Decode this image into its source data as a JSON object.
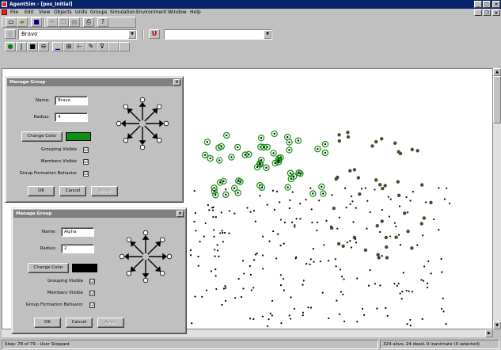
{
  "window": {
    "title": "AgentSim - [pos_Initial]"
  },
  "window_buttons": {
    "minimize": "_",
    "maximize": "□",
    "close": "×"
  },
  "mdi_buttons": {
    "minimize": "_",
    "restore": "❐",
    "close": "×"
  },
  "menu": [
    "File",
    "Edit",
    "View",
    "Objects",
    "Units",
    "Groups",
    "Simulation",
    "Environment",
    "Window",
    "Help"
  ],
  "toolbar": {
    "group_select": "Bravo",
    "second_combo": "",
    "buttons": [
      "new-icon",
      "open-icon",
      "save-icon",
      "cut-icon",
      "copy-icon",
      "paste-icon",
      "print-icon",
      "help-icon"
    ]
  },
  "status": {
    "left": "Step: 78 of 79 - User Stopped",
    "right": "324 alive, 24 dead, 0 inanimate (0 selected)"
  },
  "dialogs": [
    {
      "title": "Manage Group",
      "name_label": "Name:",
      "name": "Bravo",
      "radius_label": "Radius:",
      "radius": "4",
      "change_color": "Change Color",
      "color": "#109010",
      "grouping_visible_label": "Grouping Visible",
      "grouping_visible": "☑",
      "members_visible_label": "Members Visible",
      "members_visible": "☑",
      "formation_label": "Group Formation Behavior",
      "formation": "☑",
      "ok": "OK",
      "cancel": "Cancel",
      "apply": "Apply"
    },
    {
      "title": "Manage Group",
      "name_label": "Name:",
      "name": "Alpha",
      "radius_label": "Radius:",
      "radius": "2",
      "change_color": "Change Color",
      "color": "#000000",
      "grouping_visible_label": "Grouping Visible",
      "grouping_visible": "☑",
      "members_visible_label": "Members Visible",
      "members_visible": "☑",
      "formation_label": "Group Formation Behavior",
      "formation": "☑",
      "ok": "OK",
      "cancel": "Cancel",
      "apply": "Apply"
    }
  ],
  "colors": {
    "group_bravo": "#109010",
    "group_alpha": "#000000",
    "agent_dead": "#4a4a2a"
  }
}
